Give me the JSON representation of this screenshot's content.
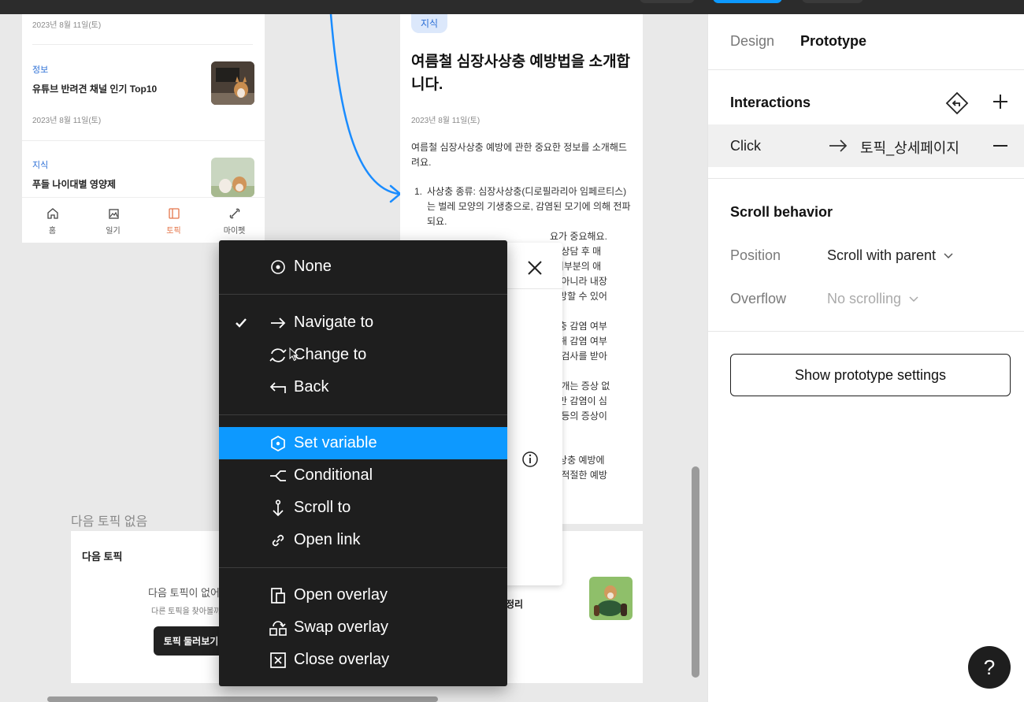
{
  "left_phone": {
    "date1": "2023년 8월 11일(토)",
    "post1_category": "정보",
    "post1_title": "유튜브 반려견 채널 인기 Top10",
    "date2": "2023년 8월 11일(토)",
    "post2_category": "지식",
    "post2_title": "푸들 나이대별 영양제",
    "tabs": [
      {
        "label": "홈",
        "icon": "home-icon"
      },
      {
        "label": "일기",
        "icon": "image-icon"
      },
      {
        "label": "토픽",
        "icon": "panel-icon"
      },
      {
        "label": "마이펫",
        "icon": "bone-icon"
      }
    ]
  },
  "article": {
    "chip": "지식",
    "title": "여름철 심장사상충 예방법을 소개합니다.",
    "date": "2023년 8월 11일(토)",
    "intro": "여름철 심장사상충 예방에 관한 중요한 정보를 소개해드려요.",
    "list_item_1": "사상충 종류: 심장사상충(디로필라리아 임페르티스)는 벌레 모양의 기생충으로, 감염된 모기에 의해 전파되요.",
    "fragments": [
      "요가 중요해요.",
      "와 상담 후 매",
      ". 대부분의 애",
      "만 아니라 내장",
      "예방할 수 있어",
      "상충 감염 여부",
      "통해 감염 여부",
      "로 검사를 받아",
      "된 개는 증상 없",
      "지만 감염이 심",
      "력 등의 증상이",
      "사상충 예방에",
      "여 적절한 예방"
    ]
  },
  "bottom": {
    "next_empty_label": "다음 토픽 없음",
    "next_topic_title": "다음 토픽",
    "no_next_text": "다음 토픽이 없어",
    "find_other_text": "다른 토픽을 찾아볼까",
    "browse_button": "토픽 둘러보기",
    "related_post_fragment": "정리"
  },
  "menu": {
    "items": [
      {
        "label": "None",
        "icon": "target-icon",
        "checked": false,
        "selected": false
      },
      {
        "label": "Navigate to",
        "icon": "arrow-right-icon",
        "checked": true,
        "selected": false
      },
      {
        "label": "Change to",
        "icon": "swap-arrows-icon",
        "checked": false,
        "selected": false
      },
      {
        "label": "Back",
        "icon": "back-arrow-icon",
        "checked": false,
        "selected": false
      },
      {
        "label": "Set variable",
        "icon": "hexagon-icon",
        "checked": false,
        "selected": true
      },
      {
        "label": "Conditional",
        "icon": "branch-icon",
        "checked": false,
        "selected": false
      },
      {
        "label": "Scroll to",
        "icon": "anchor-icon",
        "checked": false,
        "selected": false
      },
      {
        "label": "Open link",
        "icon": "link-icon",
        "checked": false,
        "selected": false
      },
      {
        "label": "Open overlay",
        "icon": "open-overlay-icon",
        "checked": false,
        "selected": false
      },
      {
        "label": "Swap overlay",
        "icon": "swap-overlay-icon",
        "checked": false,
        "selected": false
      },
      {
        "label": "Close overlay",
        "icon": "close-overlay-icon",
        "checked": false,
        "selected": false
      }
    ]
  },
  "right_panel": {
    "tabs": {
      "design": "Design",
      "prototype": "Prototype"
    },
    "interactions_title": "Interactions",
    "interaction": {
      "trigger": "Click",
      "destination": "토픽_상세페이지"
    },
    "scroll_title": "Scroll behavior",
    "position_label": "Position",
    "position_value": "Scroll with parent",
    "overflow_label": "Overflow",
    "overflow_value": "No scrolling",
    "settings_button": "Show prototype settings",
    "help_label": "?"
  },
  "colors": {
    "accent": "#0d99ff",
    "menu_bg": "#1e1e1e",
    "link_blue": "#2c6fd6",
    "tab_active": "#e4764a"
  }
}
